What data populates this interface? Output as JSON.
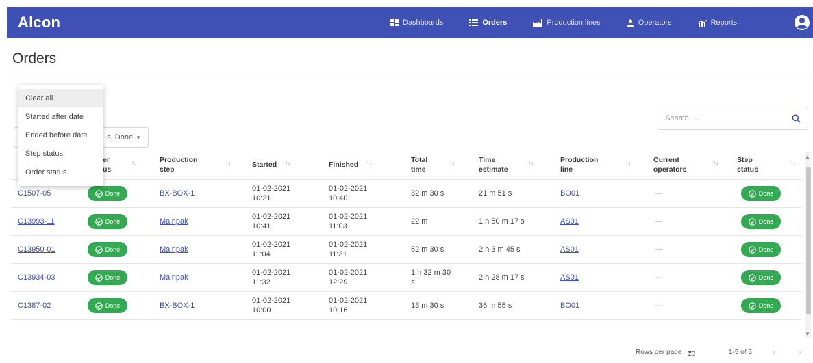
{
  "app": {
    "name": "Alcon"
  },
  "nav": {
    "items": [
      {
        "label": "Dashboards",
        "icon": "dashboard-icon"
      },
      {
        "label": "Orders",
        "icon": "list-icon"
      },
      {
        "label": "Production lines",
        "icon": "factory-icon"
      },
      {
        "label": "Operators",
        "icon": "person-icon"
      },
      {
        "label": "Reports",
        "icon": "chart-icon"
      }
    ],
    "active": "Orders"
  },
  "page": {
    "title": "Orders"
  },
  "search": {
    "placeholder": "Search ..."
  },
  "filter": {
    "chip_text": "s, Done"
  },
  "menu": {
    "items": [
      "Clear all",
      "Started after date",
      "Ended before date",
      "Step status",
      "Order status"
    ]
  },
  "table": {
    "headers": {
      "order_status": "er\nus",
      "production_step": "Production\nstep",
      "started": "Started",
      "finished": "Finished",
      "total_time": "Total\ntime",
      "time_estimate": "Time\nestimate",
      "production_line": "Production\nline",
      "current_operators": "Current\noperators",
      "step_status": "Step\nstatus"
    },
    "rows": [
      {
        "order": "C1507-05",
        "order_status": "Done",
        "step": "BX-BOX-1",
        "started": "01-02-2021\n10:21",
        "finished": "01-02-2021\n10:40",
        "total": "32 m 30 s",
        "estimate": "21 m 51 s",
        "line": "BO01",
        "operators": "—",
        "step_status": "Done"
      },
      {
        "order": "C13993-11",
        "order_status": "Done",
        "step": "Mainpak",
        "started": "01-02-2021\n10:41",
        "finished": "01-02-2021\n11:03",
        "total": "22 m",
        "estimate": "1 h 50 m 17 s",
        "line": "AS01",
        "operators": "—",
        "step_status": "Done"
      },
      {
        "order": "C13950-01",
        "order_status": "Done",
        "step": "Mainpak",
        "started": "01-02-2021\n11:04",
        "finished": "01-02-2021\n11:31",
        "total": "52 m 30 s",
        "estimate": "2 h 3 m 45 s",
        "line": "AS01",
        "operators": "—",
        "step_status": "Done"
      },
      {
        "order": "C13934-03",
        "order_status": "Done",
        "step": "Mainpak",
        "started": "01-02-2021\n11:32",
        "finished": "01-02-2021\n12:29",
        "total": "1 h 32 m 30\ns",
        "estimate": "2 h 28 m 17 s",
        "line": "AS01",
        "operators": "—",
        "step_status": "Done"
      },
      {
        "order": "C1387-02",
        "order_status": "Done",
        "step": "BX-BOX-1",
        "started": "01-02-2021\n10:00",
        "finished": "01-02-2021\n10:16",
        "total": "13 m 30 s",
        "estimate": "36 m 55 s",
        "line": "BO01",
        "operators": "—",
        "step_status": "Done"
      }
    ]
  },
  "pagination": {
    "rows_per_page_label": "Rows per page",
    "rows_per_page": "20",
    "range": "1-5 of 5"
  },
  "colors": {
    "primary": "#3f51b5",
    "success": "#34a853"
  }
}
